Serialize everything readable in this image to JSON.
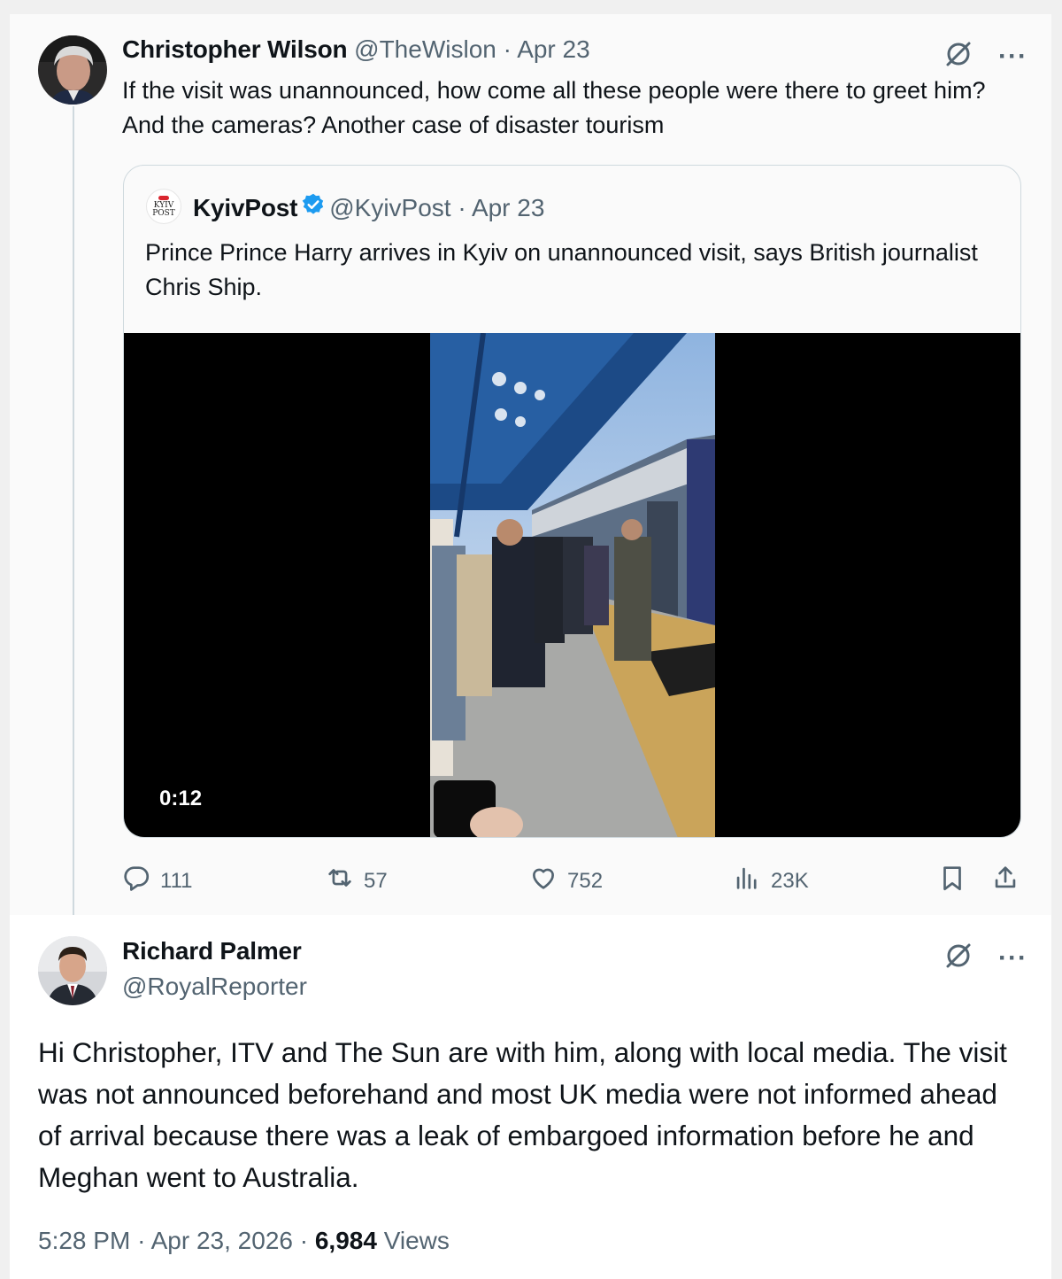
{
  "tweet": {
    "author_name": "Christopher Wilson",
    "author_handle": "@TheWislon",
    "separator": "·",
    "date": "Apr 23",
    "text": "If the visit was unannounced, how come all these people were there to greet him?  And the cameras?  Another case of disaster tourism",
    "quote": {
      "logo_text_line1": "KYIV",
      "logo_text_line2": "POST",
      "author_name": "KyivPost",
      "author_handle": "@KyivPost",
      "date": "Apr 23",
      "text": "Prince Prince Harry arrives in Kyiv on unannounced visit, says British journalist Chris Ship.",
      "video_duration": "0:12"
    },
    "actions": {
      "replies": "111",
      "reposts": "57",
      "likes": "752",
      "views": "23K"
    }
  },
  "reply": {
    "author_name": "Richard Palmer",
    "author_handle": "@RoyalReporter",
    "text": "Hi Christopher, ITV and The Sun are with him, along with local media. The visit was not announced beforehand and most UK media were not informed ahead of arrival because there was a leak of embargoed information before he and Meghan went to Australia.",
    "time": "5:28 PM",
    "date": "Apr 23, 2026",
    "view_count": "6,984",
    "views_label": "Views"
  },
  "icons": {
    "more": "more-options-icon",
    "grok": "grok-icon",
    "reply": "reply-icon",
    "repost": "repost-icon",
    "like": "like-icon",
    "views": "views-icon",
    "bookmark": "bookmark-icon",
    "share": "share-icon",
    "verified": "verified-badge-icon"
  },
  "colors": {
    "verified": "#1d9bf0",
    "muted_text": "#536471",
    "primary_text": "#0f1419",
    "border": "#cfd9de"
  }
}
